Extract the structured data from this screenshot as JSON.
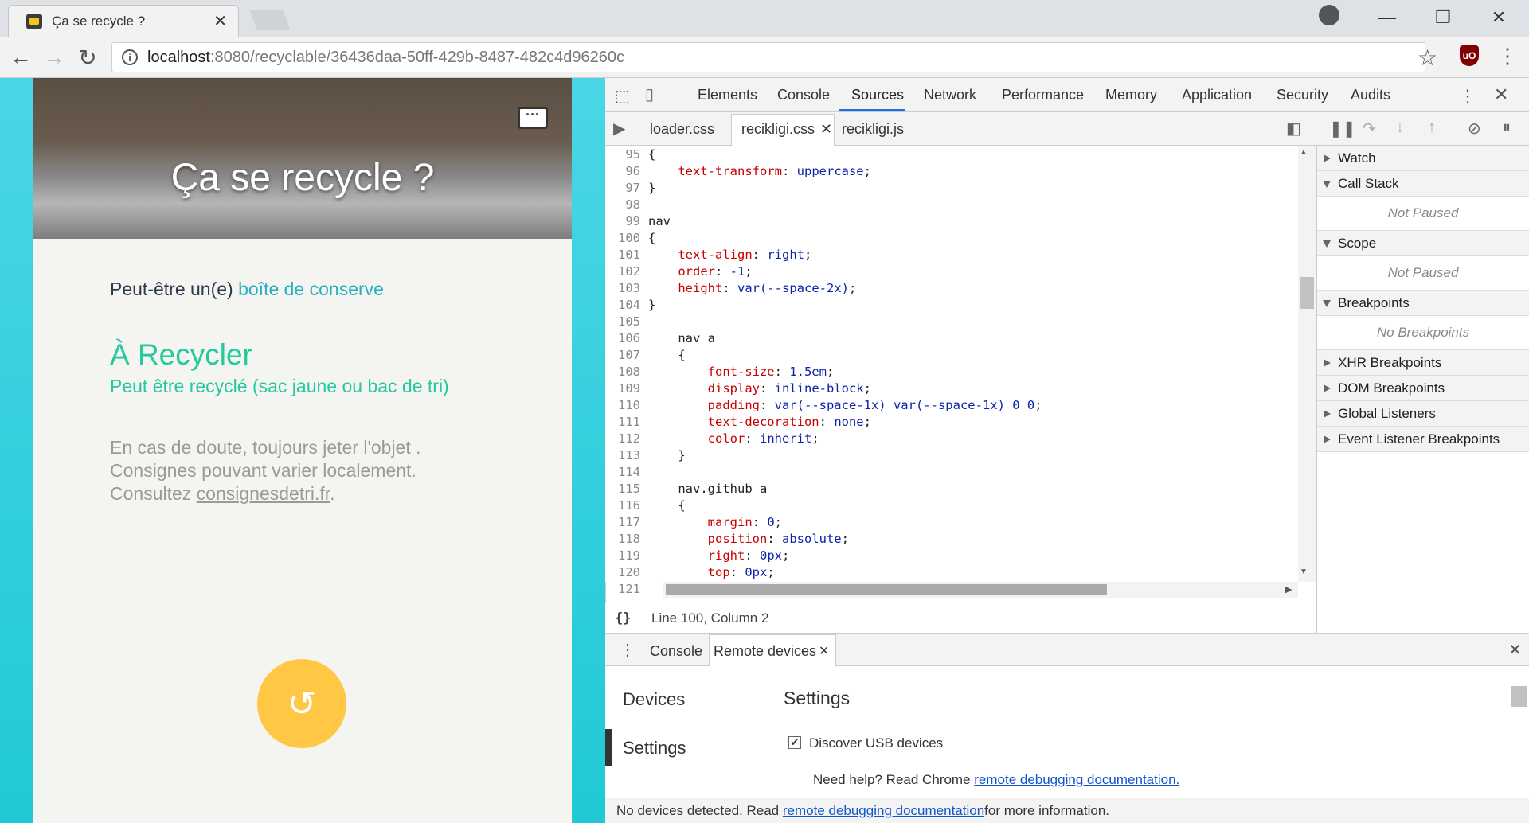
{
  "browser": {
    "tab_title": "Ça se recycle ?",
    "tab_close": "✕",
    "url_host": "localhost",
    "url_path": ":8080/recyclable/36436daa-50ff-429b-8487-482c4d96260c",
    "window_controls": {
      "minimize": "—",
      "restore": "❐",
      "close": "✕"
    }
  },
  "page": {
    "title": "Ça se recycle ?",
    "maybe_prefix": "Peut-être un(e) ",
    "maybe_item": "boîte de conserve",
    "status": "À Recycler",
    "status_detail": "Peut être recyclé (sac jaune ou bac de tri)",
    "doubt_line1": "En cas de doute, toujours jeter l'objet .",
    "doubt_line2": "Consignes pouvant varier localement.",
    "doubt_line3_prefix": "Consultez ",
    "doubt_link": "consignesdetri.fr",
    "doubt_line3_suffix": "."
  },
  "devtools": {
    "tabs": [
      "Elements",
      "Console",
      "Sources",
      "Network",
      "Performance",
      "Memory",
      "Application",
      "Security",
      "Audits"
    ],
    "active_tab": "Sources",
    "files": [
      "loader.css",
      "recikligi.css",
      "recikligi.js"
    ],
    "active_file": "recikligi.css",
    "cursor_position": "Line 100, Column 2",
    "code_lines": [
      {
        "n": "95",
        "t": "{"
      },
      {
        "n": "96",
        "t": "    text-transform: uppercase;"
      },
      {
        "n": "97",
        "t": "}"
      },
      {
        "n": "98",
        "t": ""
      },
      {
        "n": "99",
        "t": "nav"
      },
      {
        "n": "100",
        "t": "{"
      },
      {
        "n": "101",
        "t": "    text-align: right;"
      },
      {
        "n": "102",
        "t": "    order: -1;"
      },
      {
        "n": "103",
        "t": "    height: var(--space-2x);"
      },
      {
        "n": "104",
        "t": "}"
      },
      {
        "n": "105",
        "t": ""
      },
      {
        "n": "106",
        "t": "    nav a"
      },
      {
        "n": "107",
        "t": "    {"
      },
      {
        "n": "108",
        "t": "        font-size: 1.5em;"
      },
      {
        "n": "109",
        "t": "        display: inline-block;"
      },
      {
        "n": "110",
        "t": "        padding: var(--space-1x) var(--space-1x) 0 0;"
      },
      {
        "n": "111",
        "t": "        text-decoration: none;"
      },
      {
        "n": "112",
        "t": "        color: inherit;"
      },
      {
        "n": "113",
        "t": "    }"
      },
      {
        "n": "114",
        "t": ""
      },
      {
        "n": "115",
        "t": "    nav.github a"
      },
      {
        "n": "116",
        "t": "    {"
      },
      {
        "n": "117",
        "t": "        margin: 0;"
      },
      {
        "n": "118",
        "t": "        position: absolute;"
      },
      {
        "n": "119",
        "t": "        right: 0px;"
      },
      {
        "n": "120",
        "t": "        top: 0px;"
      },
      {
        "n": "121",
        "t": ""
      }
    ],
    "debugger": {
      "watch": "Watch",
      "call_stack": "Call Stack",
      "call_stack_empty": "Not Paused",
      "scope": "Scope",
      "scope_empty": "Not Paused",
      "breakpoints": "Breakpoints",
      "breakpoints_empty": "No Breakpoints",
      "xhr": "XHR Breakpoints",
      "dom": "DOM Breakpoints",
      "global": "Global Listeners",
      "event": "Event Listener Breakpoints"
    },
    "drawer": {
      "tabs": [
        "Console",
        "Remote devices"
      ],
      "active_tab": "Remote devices",
      "nav_devices": "Devices",
      "nav_settings": "Settings",
      "settings_heading": "Settings",
      "discover_usb": "Discover USB devices",
      "discover_usb_checked": true,
      "help_prefix": "Need help? Read Chrome ",
      "help_link": "remote debugging documentation.",
      "status_prefix": "No devices detected. Read ",
      "status_link": "remote debugging documentation",
      "status_suffix": " for more information."
    }
  }
}
